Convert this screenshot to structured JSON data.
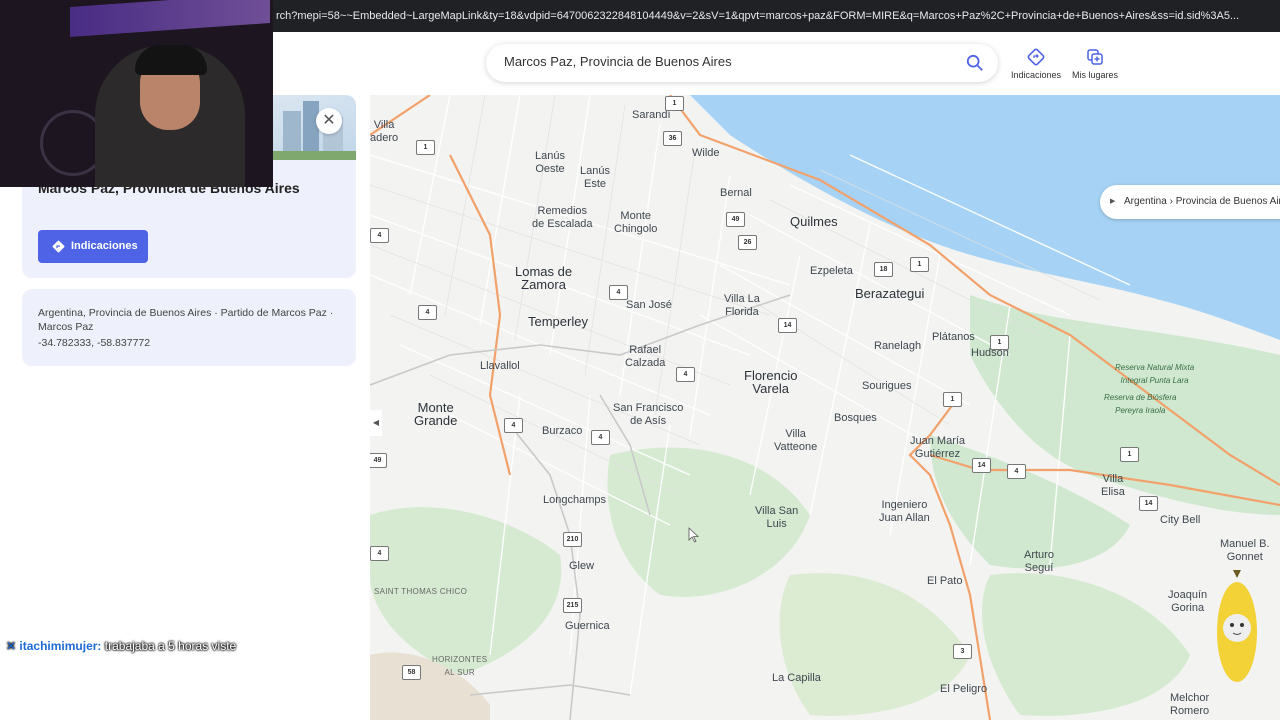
{
  "browser": {
    "url": "rch?mepi=58~~Embedded~LargeMapLink&ty=18&vdpid=6470062322848104449&v=2&sV=1&qpvt=marcos+paz&FORM=MIRE&q=Marcos+Paz%2C+Provincia+de+Buenos+Aires&ss=id.sid%3A5..."
  },
  "search": {
    "value": "Marcos Paz, Provincia de Buenos Aires"
  },
  "top_actions": {
    "directions": "Indicaciones",
    "my_places": "Mis lugares"
  },
  "panel": {
    "title": "Marcos Paz, Provincia de Buenos Aires",
    "directions_button": "Indicaciones",
    "address": "Argentina, Provincia de Buenos Aires · Partido de Marcos Paz · Marcos Paz",
    "coordinates": "-34.782333, -58.837772"
  },
  "breadcrumb": "Argentina › Provincia de Buenos Aires",
  "chat": {
    "user": "itachimimujer:",
    "message": "trabajaba a 5 horas viste"
  },
  "map": {
    "places": [
      {
        "id": "villa-madero",
        "lines": [
          "Villa",
          "adero"
        ]
      },
      {
        "id": "sarandi",
        "lines": [
          "Sarandí"
        ]
      },
      {
        "id": "lanus-oeste",
        "lines": [
          "Lanús",
          "Oeste"
        ]
      },
      {
        "id": "lanus-este",
        "lines": [
          "Lanús",
          "Este"
        ]
      },
      {
        "id": "wilde",
        "lines": [
          "Wilde"
        ]
      },
      {
        "id": "bernal",
        "lines": [
          "Bernal"
        ]
      },
      {
        "id": "remedios-de-escalada",
        "lines": [
          "Remedios",
          "de Escalada"
        ]
      },
      {
        "id": "monte-chingolo",
        "lines": [
          "Monte",
          "Chingolo"
        ]
      },
      {
        "id": "quilmes",
        "lines": [
          "Quilmes"
        ]
      },
      {
        "id": "lomas-de-zamora",
        "lines": [
          "Lomas de",
          "Zamora"
        ]
      },
      {
        "id": "ezpeleta",
        "lines": [
          "Ezpeleta"
        ]
      },
      {
        "id": "berazategui",
        "lines": [
          "Berazategui"
        ]
      },
      {
        "id": "san-jose",
        "lines": [
          "San José"
        ]
      },
      {
        "id": "villa-la-florida",
        "lines": [
          "Villa La",
          "Florida"
        ]
      },
      {
        "id": "temperley",
        "lines": [
          "Temperley"
        ]
      },
      {
        "id": "platanos",
        "lines": [
          "Plátanos"
        ]
      },
      {
        "id": "hudson",
        "lines": [
          "Hudson"
        ]
      },
      {
        "id": "ranelagh",
        "lines": [
          "Ranelagh"
        ]
      },
      {
        "id": "rafael-calzada",
        "lines": [
          "Rafael",
          "Calzada"
        ]
      },
      {
        "id": "llavallol",
        "lines": [
          "Llavallol"
        ]
      },
      {
        "id": "florencio-varela",
        "lines": [
          "Florencio",
          "Varela"
        ]
      },
      {
        "id": "sourigues",
        "lines": [
          "Sourigues"
        ]
      },
      {
        "id": "monte-grande",
        "lines": [
          "Monte",
          "Grande"
        ]
      },
      {
        "id": "san-francisco-de-asis",
        "lines": [
          "San Francisco",
          "de Asís"
        ]
      },
      {
        "id": "bosques",
        "lines": [
          "Bosques"
        ]
      },
      {
        "id": "burzaco",
        "lines": [
          "Burzaco"
        ]
      },
      {
        "id": "villa-vatteone",
        "lines": [
          "Villa",
          "Vatteone"
        ]
      },
      {
        "id": "juan-maria-gutierrez",
        "lines": [
          "Juan María",
          "Gutiérrez"
        ]
      },
      {
        "id": "villa-elisa",
        "lines": [
          "Villa",
          "Elisa"
        ]
      },
      {
        "id": "longchamps",
        "lines": [
          "Longchamps"
        ]
      },
      {
        "id": "ingeniero-juan-allan",
        "lines": [
          "Ingeniero",
          "Juan Allan"
        ]
      },
      {
        "id": "villa-san-luis",
        "lines": [
          "Villa San",
          "Luis"
        ]
      },
      {
        "id": "city-bell",
        "lines": [
          "City Bell"
        ]
      },
      {
        "id": "manuel-b-gonnet",
        "lines": [
          "Manuel B.",
          "Gonnet"
        ]
      },
      {
        "id": "glew",
        "lines": [
          "Glew"
        ]
      },
      {
        "id": "arturo-segui",
        "lines": [
          "Arturo",
          "Seguí"
        ]
      },
      {
        "id": "el-pato",
        "lines": [
          "El Pato"
        ]
      },
      {
        "id": "joaquin-gorina",
        "lines": [
          "Joaquín",
          "Gorina"
        ]
      },
      {
        "id": "guernica",
        "lines": [
          "Guernica"
        ]
      },
      {
        "id": "la-capilla",
        "lines": [
          "La Capilla"
        ]
      },
      {
        "id": "el-peligro",
        "lines": [
          "El Peligro"
        ]
      },
      {
        "id": "melchor-romero",
        "lines": [
          "Melchor",
          "Romero"
        ]
      }
    ],
    "minor_places": [
      "SAINT THOMAS CHICO",
      "HORIZONTES AL SUR"
    ],
    "parks": [
      [
        "Reserva Natural Mixta",
        "Integral Punta Lara"
      ],
      [
        "Reserva de Biósfera",
        "Pereyra Iraola"
      ]
    ],
    "route_shields": [
      "1",
      "36",
      "1",
      "49",
      "26",
      "4",
      "18",
      "1",
      "4",
      "4",
      "14",
      "49",
      "4",
      "4",
      "4",
      "1",
      "1",
      "14",
      "4",
      "1",
      "14",
      "210",
      "215",
      "58",
      "3",
      "4"
    ]
  }
}
